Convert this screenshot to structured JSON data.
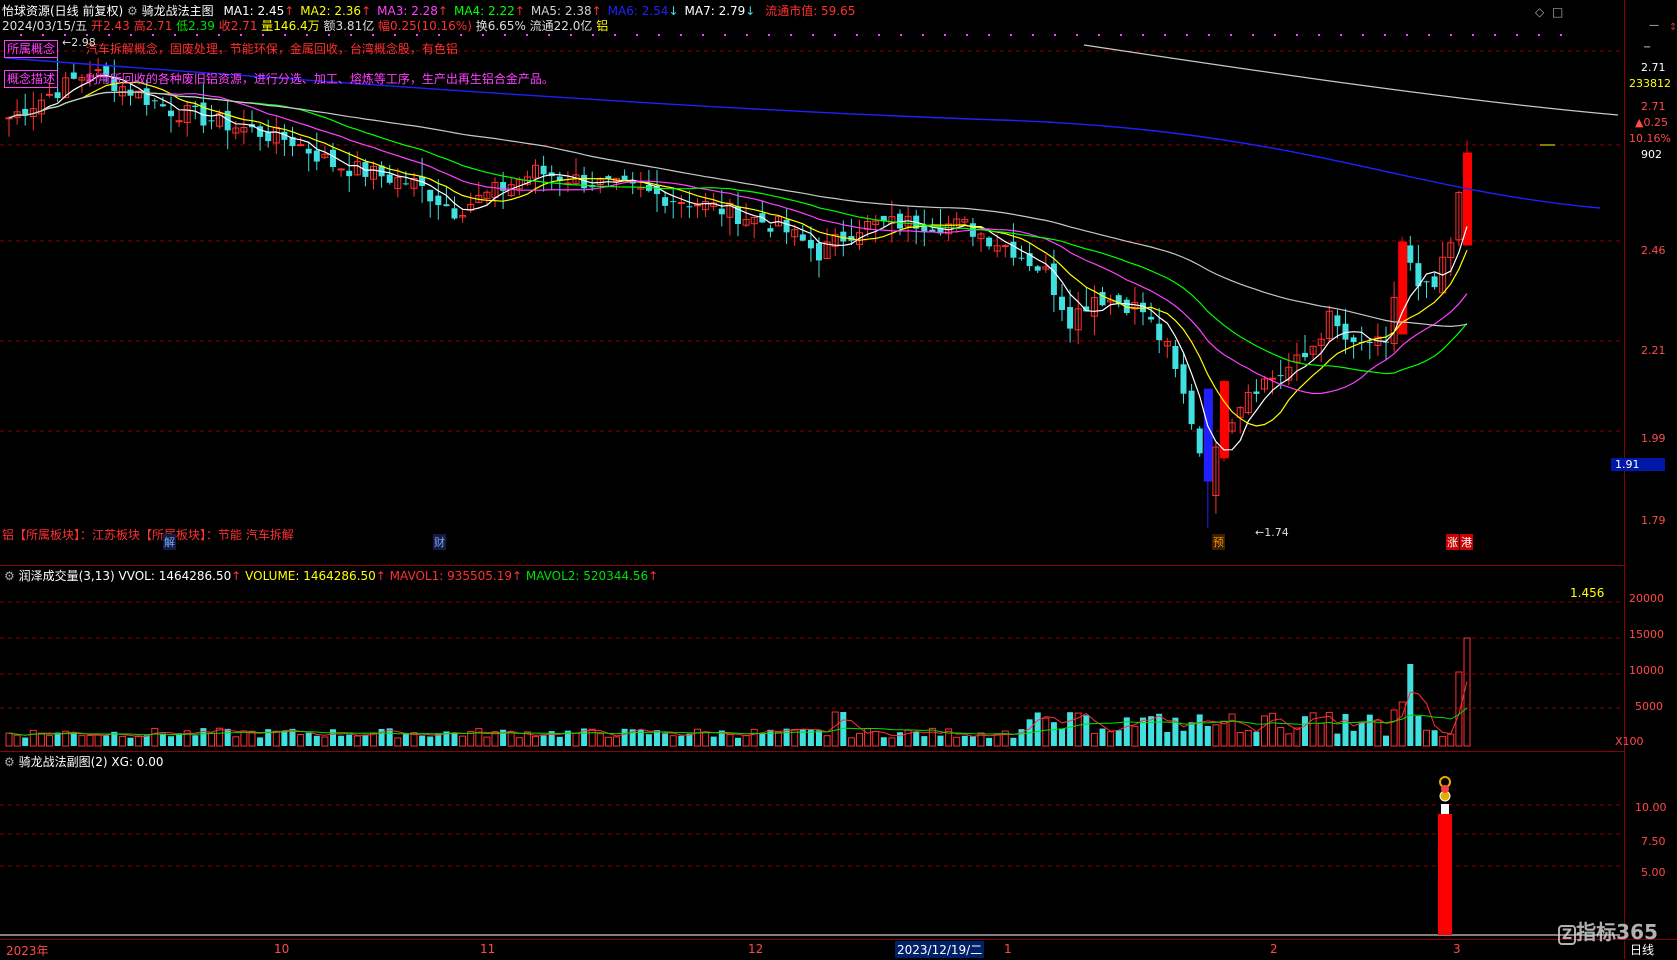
{
  "header": {
    "stock_name": "怡球资源(日线 前复权)",
    "indicator_name": "骑龙战法主图",
    "ma": [
      {
        "label": "MA1: 2.45",
        "color": "#ffffff",
        "arrow": "↑"
      },
      {
        "label": "MA2: 2.36",
        "color": "#ffff00",
        "arrow": "↑"
      },
      {
        "label": "MA3: 2.28",
        "color": "#ff40ff",
        "arrow": "↑"
      },
      {
        "label": "MA4: 2.22",
        "color": "#00ff00",
        "arrow": "↑"
      },
      {
        "label": "MA5: 2.38",
        "color": "#d0d0d0",
        "arrow": "↑"
      },
      {
        "label": "MA6: 2.54",
        "color": "#2020ff",
        "arrow": "↓"
      },
      {
        "label": "MA7: 2.79",
        "color": "#ffffff",
        "arrow": "↓"
      }
    ],
    "market_cap": "流通市值: 59.65",
    "date": "2024/03/15/五",
    "open": "开2.43",
    "high": "高2.71",
    "low": "低2.39",
    "close": "收2.71",
    "volume": "量146.4万",
    "amount": "额3.81亿",
    "change": "幅0.25(10.16%)",
    "turnover": "换6.65%",
    "float": "流通22.0亿",
    "sector": "铝"
  },
  "concepts": {
    "tag1": "所属概念",
    "text1": "汽车拆解概念，固废处理，节能环保，金属回收，台湾概念股，有色铝",
    "tag2": "概念描述",
    "text2": "利用所回收的各种废旧铝资源，进行分选、加工、熔炼等工序，生产出再生铝合金产品。",
    "board_line": "铝【所属板块】：江苏板块【所属板块】：节能 汽车拆解"
  },
  "price_labels": {
    "high_mark": "2.98",
    "low_mark": "1.74"
  },
  "event_markers": [
    {
      "text": "解",
      "color": "#6fa8ff"
    },
    {
      "text": "财",
      "color": "#6fa8ff"
    },
    {
      "text": "预",
      "color": "#ff8c00"
    },
    {
      "text": "涨",
      "color": "#ffffff",
      "bg": "#cc0000"
    },
    {
      "text": "港",
      "color": "#ffffff",
      "bg": "#cc0000"
    }
  ],
  "right_axis": {
    "top_value": "2.71",
    "volume_cur": "233812",
    "last_price": "2.71",
    "change_abs": "▲0.25",
    "change_pct": "10.16%",
    "misc": "902",
    "cursor_price": "1.91",
    "price_ticks": [
      "2.46",
      "2.21",
      "1.99",
      "1.79"
    ],
    "vol_ticks": [
      "20000",
      "15000",
      "10000",
      "5000"
    ],
    "vol_unit": "X100",
    "sub_ticks": [
      "10.00",
      "7.50",
      "5.00"
    ],
    "period": "日线"
  },
  "volume_panel": {
    "title": "润泽成交量(3,13)",
    "vvol": "VVOL: 1464286.50",
    "volume": "VOLUME: 1464286.50",
    "mavol1": "MAVOL1: 935505.19",
    "mavol2": "MAVOL2: 520344.56",
    "ratio": "1.456"
  },
  "sub_panel": {
    "title": "骑龙战法副图(2)",
    "xg": "XG: 0.00"
  },
  "date_axis": {
    "labels": [
      "2023年",
      "10",
      "11",
      "12",
      "2023/12/19/二",
      "1",
      "2",
      "3"
    ]
  },
  "watermark": "指标365",
  "colors": {
    "up": "#ff3030",
    "down": "#40e0e0",
    "grid_red": "#8b0000",
    "signal_red": "#ff0000",
    "signal_blue": "#2020ff"
  },
  "chart_data": {
    "type": "candlestick",
    "title": "怡球资源(日线 前复权)",
    "y_range": [
      1.74,
      2.98
    ],
    "last_close": 2.71,
    "highest": 2.98,
    "lowest": 1.74
  }
}
